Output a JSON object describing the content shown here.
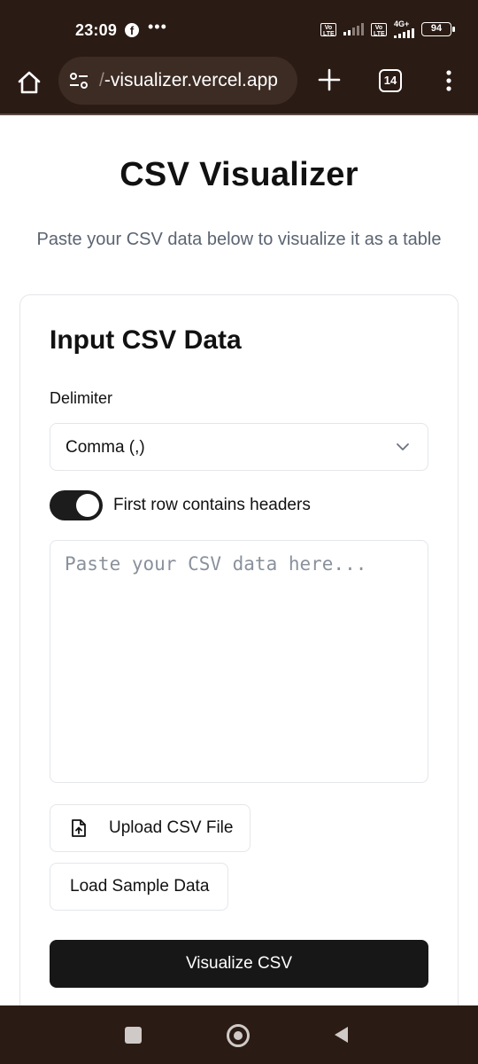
{
  "status_bar": {
    "time": "23:09",
    "notification_icons": [
      "facebook-icon",
      "more-icon"
    ],
    "sim1_label": "Vo LTE",
    "sim2_label": "Vo LTE",
    "network_type": "4G+",
    "battery": "94"
  },
  "browser": {
    "url_faded": "/",
    "url": "-visualizer.vercel.app",
    "tab_count": "14",
    "icons": [
      "home-icon",
      "site-settings-icon",
      "new-tab-icon",
      "tab-switcher-icon",
      "menu-icon"
    ]
  },
  "page": {
    "title": "CSV Visualizer",
    "subtitle": "Paste your CSV data below to visualize it as a table"
  },
  "card": {
    "title": "Input CSV Data",
    "delimiter_label": "Delimiter",
    "delimiter_value": "Comma (,)",
    "headers_toggle_label": "First row contains headers",
    "headers_toggle_on": true,
    "textarea_placeholder": "Paste your CSV data here...",
    "textarea_value": "",
    "upload_button": "Upload CSV File",
    "sample_button": "Load Sample Data",
    "visualize_button": "Visualize CSV"
  },
  "colors": {
    "system_bar": "#2a1b14",
    "primary_button": "#171717",
    "subtitle": "#5b6472",
    "border": "#e4e6ea"
  }
}
